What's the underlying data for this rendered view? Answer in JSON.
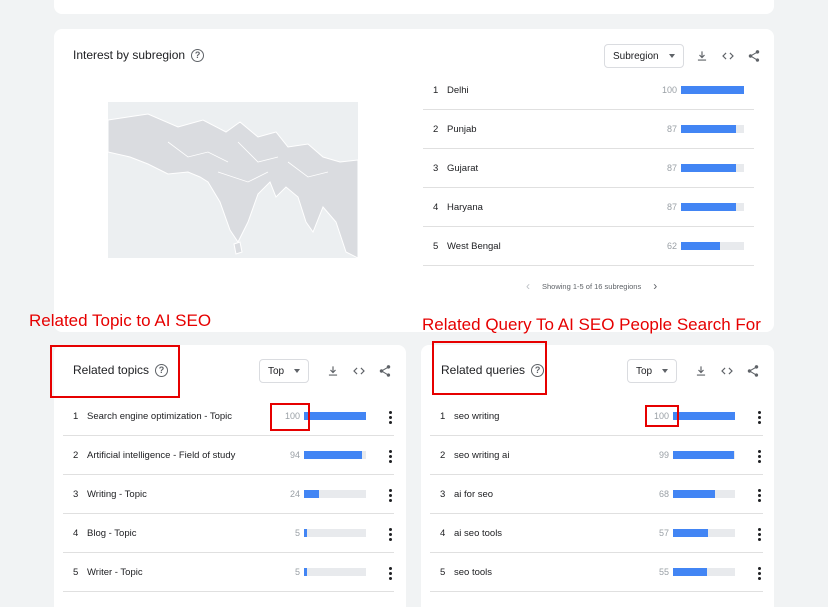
{
  "subregion": {
    "title": "Interest by subregion",
    "select_value": "Subregion",
    "rows": [
      {
        "rank": "1",
        "name": "Delhi",
        "value": 100
      },
      {
        "rank": "2",
        "name": "Punjab",
        "value": 87
      },
      {
        "rank": "3",
        "name": "Gujarat",
        "value": 87
      },
      {
        "rank": "4",
        "name": "Haryana",
        "value": 87
      },
      {
        "rank": "5",
        "name": "West Bengal",
        "value": 62
      }
    ],
    "pager_text": "Showing 1-5 of 16 subregions"
  },
  "topics": {
    "title": "Related topics",
    "select_value": "Top",
    "rows": [
      {
        "rank": "1",
        "name": "Search engine optimization - Topic",
        "value": 100
      },
      {
        "rank": "2",
        "name": "Artificial intelligence - Field of study",
        "value": 94
      },
      {
        "rank": "3",
        "name": "Writing - Topic",
        "value": 24
      },
      {
        "rank": "4",
        "name": "Blog - Topic",
        "value": 5
      },
      {
        "rank": "5",
        "name": "Writer - Topic",
        "value": 5
      }
    ]
  },
  "queries": {
    "title": "Related queries",
    "select_value": "Top",
    "rows": [
      {
        "rank": "1",
        "name": "seo writing",
        "value": 100
      },
      {
        "rank": "2",
        "name": "seo writing ai",
        "value": 99
      },
      {
        "rank": "3",
        "name": "ai for seo",
        "value": 68
      },
      {
        "rank": "4",
        "name": "ai seo tools",
        "value": 57
      },
      {
        "rank": "5",
        "name": "seo tools",
        "value": 55
      }
    ]
  },
  "annotations": {
    "topics": "Related Topic to AI SEO",
    "queries": "Related Query To AI SEO People Search For"
  },
  "colors": {
    "bar": "#4285f4",
    "annotation": "#e60000"
  }
}
